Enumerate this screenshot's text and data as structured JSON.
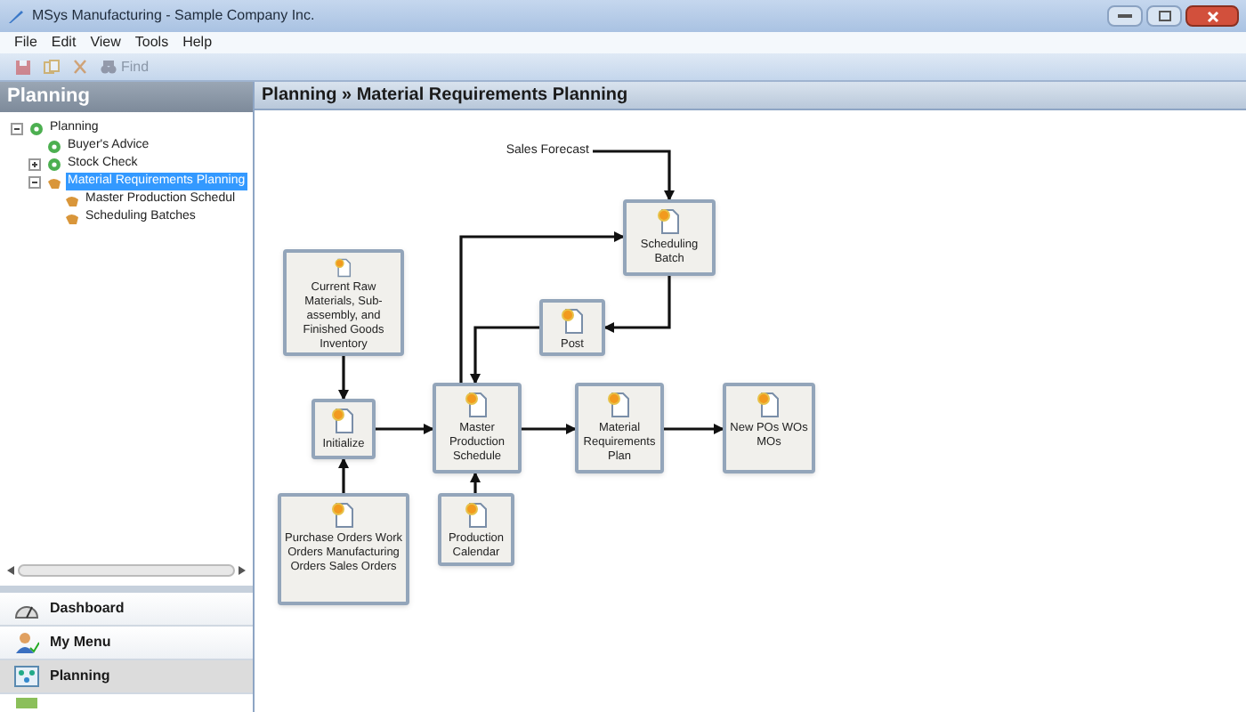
{
  "window": {
    "title": "MSys Manufacturing - Sample Company Inc."
  },
  "menu": [
    "File",
    "Edit",
    "View",
    "Tools",
    "Help"
  ],
  "toolbar": {
    "find_label": "Find",
    "disabled": true
  },
  "sidebar": {
    "title": "Planning",
    "tree": [
      {
        "label": "Planning",
        "expanded": true,
        "selected": false,
        "children": [
          {
            "label": "Buyer's Advice",
            "selected": false
          },
          {
            "label": "Stock Check",
            "expanded": false,
            "selected": false
          },
          {
            "label": "Material Requirements Planning",
            "expanded": true,
            "selected": true,
            "children": [
              {
                "label": "Master Production Schedul",
                "selected": false
              },
              {
                "label": "Scheduling Batches",
                "selected": false
              }
            ]
          }
        ]
      }
    ],
    "nav": [
      {
        "label": "Dashboard",
        "selected": false
      },
      {
        "label": "My Menu",
        "selected": false
      },
      {
        "label": "Planning",
        "selected": true
      }
    ]
  },
  "breadcrumb": "Planning » Material Requirements Planning",
  "diagram": {
    "nodes": [
      {
        "kind": "text",
        "label": "Sales Forecast"
      },
      {
        "kind": "document",
        "label": "Scheduling Batch"
      },
      {
        "kind": "document",
        "label": "Current Raw Materials, Sub-assembly, and Finished Goods Inventory"
      },
      {
        "kind": "document",
        "label": "Post"
      },
      {
        "kind": "document",
        "label": "Initialize"
      },
      {
        "kind": "document",
        "label": "Master Production Schedule"
      },
      {
        "kind": "document",
        "label": "Material Requirements Plan"
      },
      {
        "kind": "document",
        "label": "New POs WOs MOs"
      },
      {
        "kind": "document",
        "label": "Purchase Orders Work Orders Manufacturing Orders Sales Orders"
      },
      {
        "kind": "document",
        "label": "Production Calendar"
      }
    ]
  }
}
